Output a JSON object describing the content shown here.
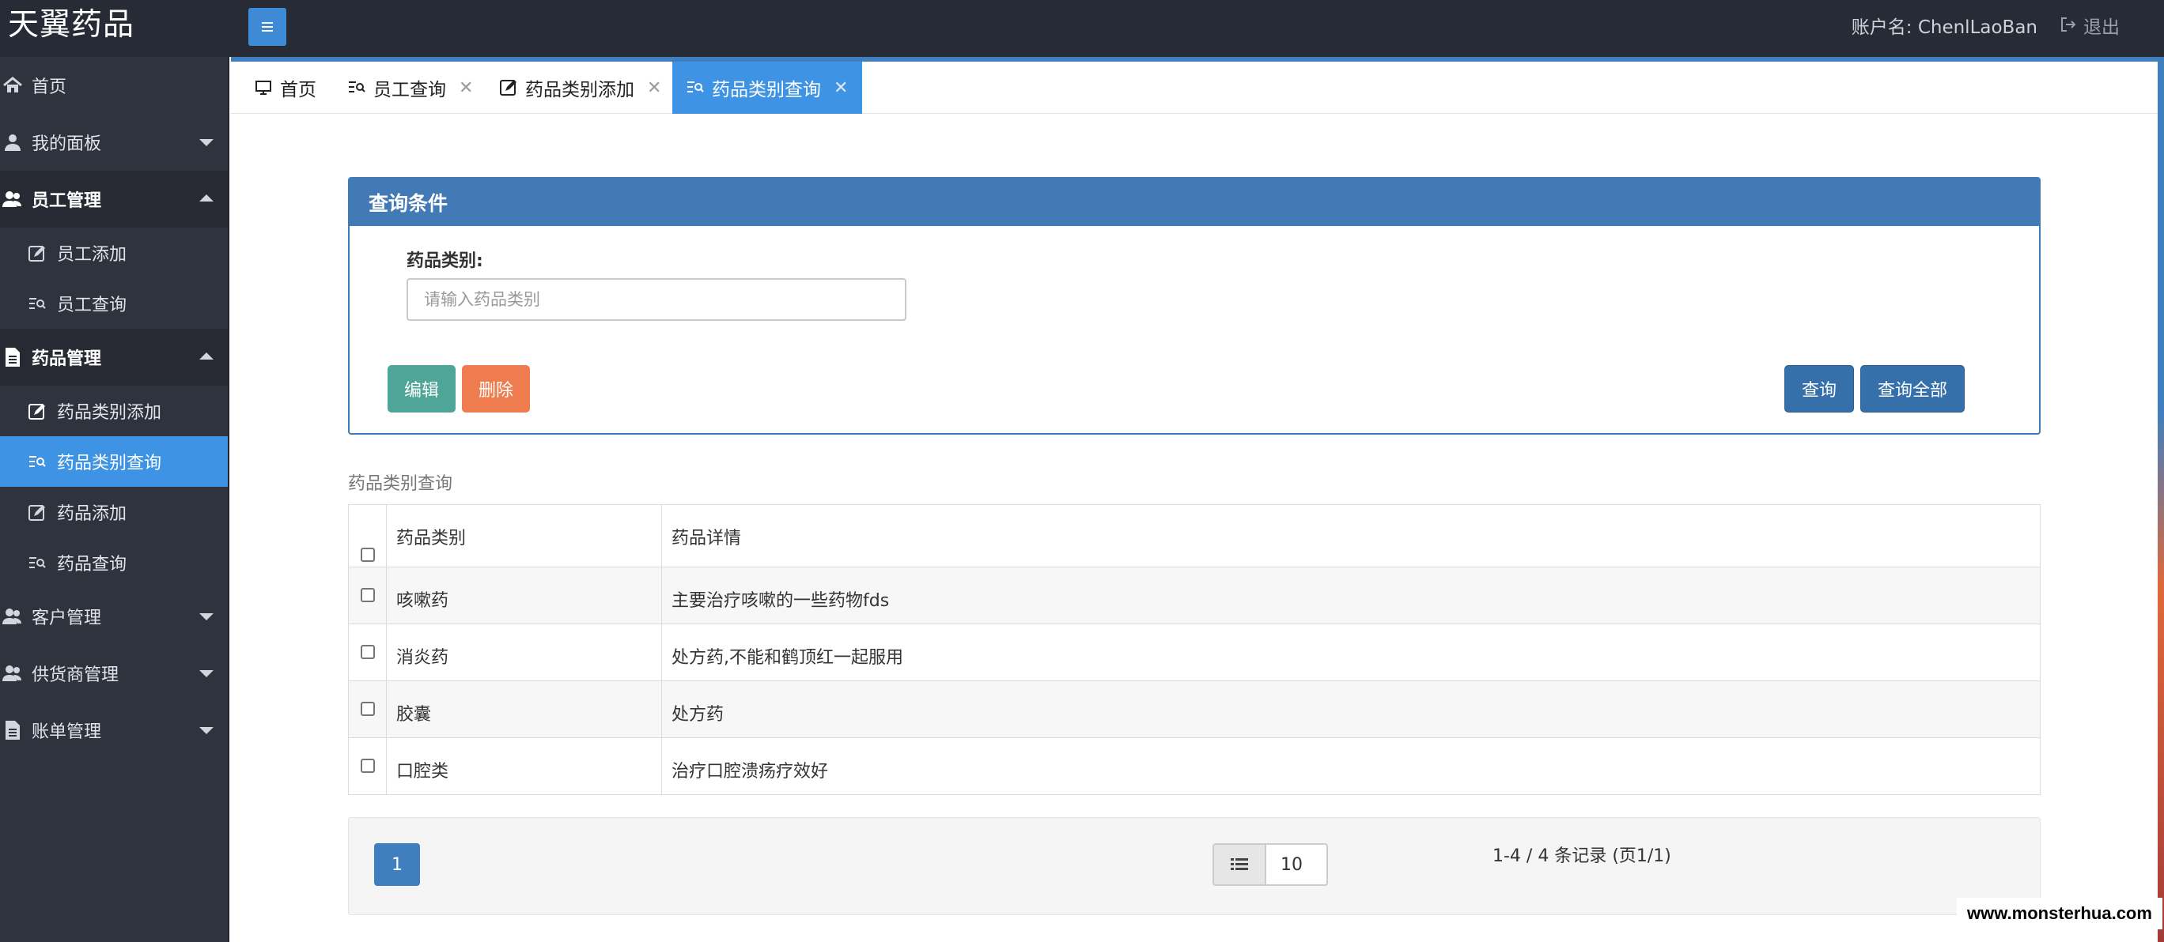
{
  "app": {
    "brand": "天翼药品"
  },
  "header": {
    "account_label": "账户名:",
    "account_name": "ChenlLaoBan",
    "logout_label": "退出"
  },
  "sidebar": {
    "items": [
      {
        "label": "首页",
        "icon": "home-icon"
      },
      {
        "label": "我的面板",
        "icon": "user-icon"
      },
      {
        "label": "员工管理",
        "icon": "users-icon",
        "expanded": true,
        "children": [
          {
            "label": "员工添加",
            "icon": "edit-icon"
          },
          {
            "label": "员工查询",
            "icon": "list-search-icon"
          }
        ]
      },
      {
        "label": "药品管理",
        "icon": "document-icon",
        "expanded": true,
        "children": [
          {
            "label": "药品类别添加",
            "icon": "edit-icon"
          },
          {
            "label": "药品类别查询",
            "icon": "list-search-icon",
            "active": true
          },
          {
            "label": "药品添加",
            "icon": "edit-icon"
          },
          {
            "label": "药品查询",
            "icon": "list-search-icon"
          }
        ]
      },
      {
        "label": "客户管理",
        "icon": "users-icon"
      },
      {
        "label": "供货商管理",
        "icon": "users-icon"
      },
      {
        "label": "账单管理",
        "icon": "document-icon"
      }
    ]
  },
  "tabs": [
    {
      "label": "首页",
      "icon": "monitor-icon",
      "closable": false
    },
    {
      "label": "员工查询",
      "icon": "list-search-icon",
      "closable": true
    },
    {
      "label": "药品类别添加",
      "icon": "edit-icon",
      "closable": true
    },
    {
      "label": "药品类别查询",
      "icon": "list-search-icon",
      "closable": true,
      "active": true
    }
  ],
  "query_panel": {
    "title": "查询条件",
    "field_label": "药品类别:",
    "field_placeholder": "请输入药品类别",
    "field_value": "",
    "buttons": {
      "edit": "编辑",
      "delete": "删除",
      "query": "查询",
      "query_all": "查询全部"
    }
  },
  "table": {
    "caption": "药品类别查询",
    "columns": [
      "药品类别",
      "药品详情"
    ],
    "rows": [
      {
        "category": "咳嗽药",
        "detail": "主要治疗咳嗽的一些药物fds"
      },
      {
        "category": "消炎药",
        "detail": "处方药,不能和鹤顶红一起服用"
      },
      {
        "category": "胶囊",
        "detail": "处方药"
      },
      {
        "category": "口腔类",
        "detail": "治疗口腔溃疡疗效好"
      }
    ]
  },
  "pagination": {
    "current_page": "1",
    "page_size": "10",
    "record_info": "1-4 / 4 条记录 (页1/1)"
  },
  "watermark": "www.monsterhua.com",
  "colors": {
    "navbar": "#272b35",
    "sidebar": "#2f333e",
    "accent": "#3e93e4",
    "panel_header": "#427ab5",
    "edit_button": "#4fa597",
    "delete_button": "#ef7c4f"
  }
}
